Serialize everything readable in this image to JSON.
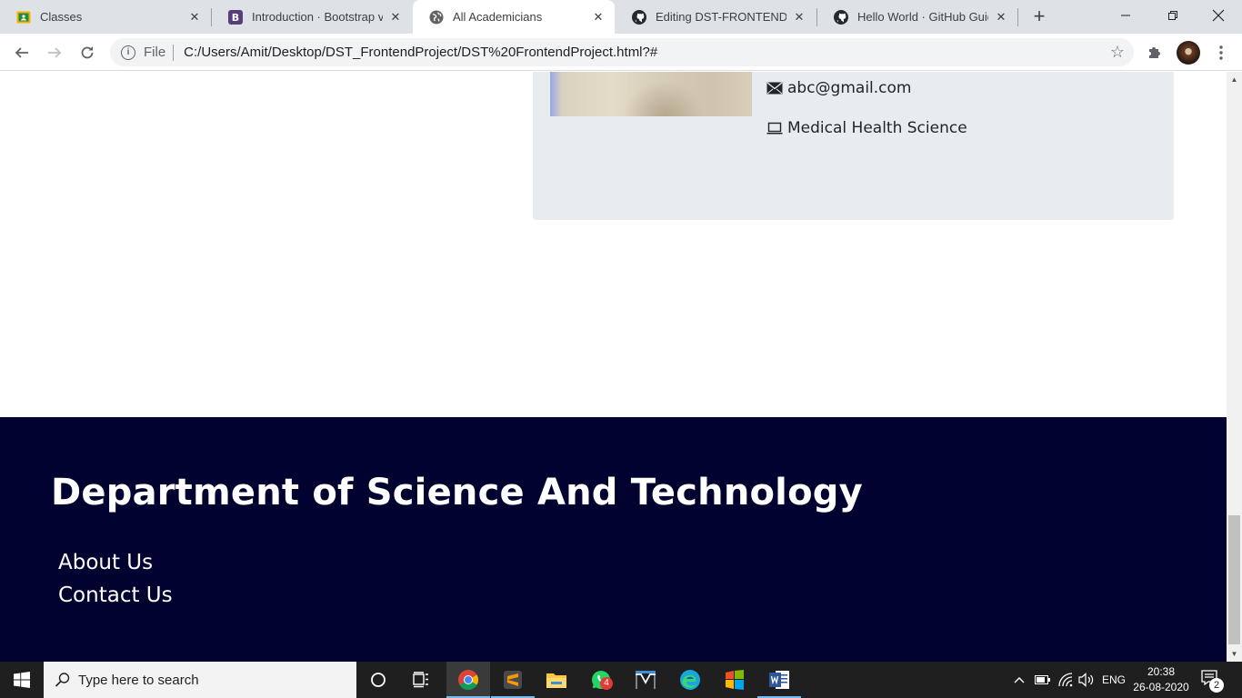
{
  "browser": {
    "tabs": [
      {
        "title": "Classes",
        "icon": "google-classroom-icon"
      },
      {
        "title": "Introduction · Bootstrap v",
        "icon": "bootstrap-icon"
      },
      {
        "title": "All Academicians",
        "icon": "globe-icon",
        "active": true
      },
      {
        "title": "Editing DST-FRONTEND/F",
        "icon": "github-icon"
      },
      {
        "title": "Hello World · GitHub Guid",
        "icon": "github-icon"
      }
    ],
    "omnibox": {
      "scheme": "File",
      "url": "C:/Users/Amit/Desktop/DST_FrontendProject/DST%20FrontendProject.html?#"
    }
  },
  "page": {
    "card": {
      "email": "abc@gmail.com",
      "department": "Medical Health Science"
    },
    "footer": {
      "heading": "Department of Science And Technology",
      "links": [
        "About Us",
        "Contact Us"
      ],
      "background": "#020230"
    }
  },
  "taskbar": {
    "search_placeholder": "Type here to search",
    "whatsapp_badge": "4",
    "language": "ENG",
    "time": "20:38",
    "date": "26-08-2020",
    "notification_count": "2"
  }
}
